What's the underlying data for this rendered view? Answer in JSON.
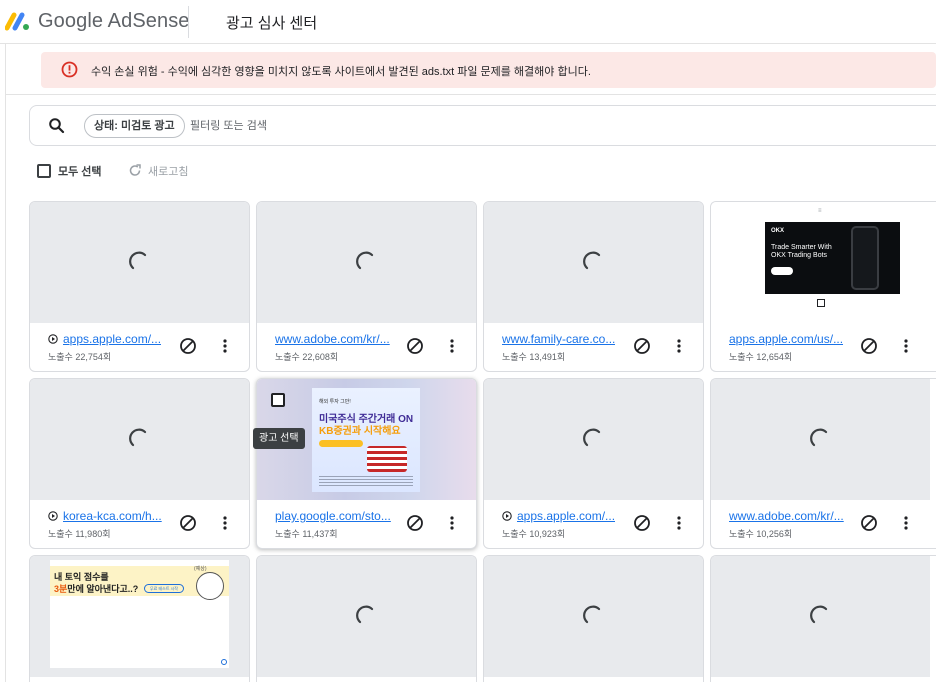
{
  "app": {
    "brand_google": "Google",
    "brand_product": "AdSense",
    "page_title": "광고 심사 센터",
    "accent": "#1a73e8"
  },
  "alert": {
    "text": "수익 손실 위험 - 수익에 심각한 영향을 미치지 않도록 사이트에서 발견된 ads.txt 파일 문제를 해결해야 합니다.",
    "icon": "error-icon",
    "color": "#d93025",
    "background": "#fce8e6"
  },
  "filter": {
    "chip_label": "상태: 미검토 광고",
    "placeholder": "필터링 또는 검색",
    "value": ""
  },
  "toolbar": {
    "select_all_label": "모두 선택",
    "refresh_label": "새로고침"
  },
  "tooltip": {
    "text": "광고 선택"
  },
  "ads": [
    {
      "domain": "apps.apple.com/...",
      "impressions": "노출수 22,754회",
      "app_icon": true
    },
    {
      "domain": "www.adobe.com/kr/...",
      "impressions": "노출수 22,608회",
      "app_icon": false
    },
    {
      "domain": "www.family-care.co...",
      "impressions": "노출수 13,491회",
      "app_icon": false
    },
    {
      "domain": "apps.apple.com/us/...",
      "impressions": "노출수 12,654회",
      "app_icon": false
    },
    {
      "domain": "korea-kca.com/h...",
      "impressions": "노출수 11,980회",
      "app_icon": true
    },
    {
      "domain": "play.google.com/sto...",
      "impressions": "노출수 11,437회",
      "app_icon": false
    },
    {
      "domain": "apps.apple.com/...",
      "impressions": "노출수 10,923회",
      "app_icon": true
    },
    {
      "domain": "www.adobe.com/kr/...",
      "impressions": "노출수 10,256회",
      "app_icon": false
    }
  ],
  "creatives": {
    "okx": {
      "logo": "OKX",
      "headline": "Trade Smarter With OKX Trading Bots"
    },
    "kb": {
      "small": "해외 투자 그만!",
      "title1": "미국주식 주간거래 ON",
      "title2": "KB증권과 시작해요"
    },
    "toeic": {
      "line1": "내 토익 점수를",
      "line2_highlight": "3분",
      "line2_rest": "만에 알아낸다고..?",
      "tag": "(예상)",
      "pill": "무료 테스트 시작"
    }
  }
}
